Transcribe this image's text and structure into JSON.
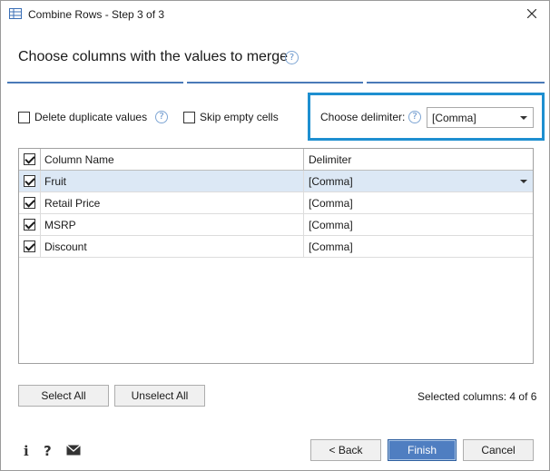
{
  "window": {
    "title": "Combine Rows - Step 3 of 3"
  },
  "header": {
    "title": "Choose columns with the values to merge"
  },
  "options": {
    "delete_duplicates": {
      "label": "Delete duplicate values",
      "checked": false
    },
    "skip_empty": {
      "label": "Skip empty cells",
      "checked": false
    },
    "delimiter_label": "Choose delimiter:",
    "delimiter_value": "[Comma]"
  },
  "grid": {
    "headers": {
      "name": "Column Name",
      "delimiter": "Delimiter"
    },
    "rows": [
      {
        "name": "Fruit",
        "delimiter": "[Comma]",
        "checked": true,
        "selected": true
      },
      {
        "name": "Retail Price",
        "delimiter": "[Comma]",
        "checked": true,
        "selected": false
      },
      {
        "name": "MSRP",
        "delimiter": "[Comma]",
        "checked": true,
        "selected": false
      },
      {
        "name": "Discount",
        "delimiter": "[Comma]",
        "checked": true,
        "selected": false
      }
    ]
  },
  "actions": {
    "select_all": "Select All",
    "unselect_all": "Unselect All",
    "selected_columns": "Selected columns: 4 of 6"
  },
  "footer": {
    "info_icon": "i",
    "help_icon": "?",
    "back": "< Back",
    "finish": "Finish",
    "cancel": "Cancel"
  },
  "colors": {
    "accent": "#1e8fd0",
    "step_bar": "#4a7ab8",
    "selected_row": "#dce8f5",
    "finish_button": "#4f7ec1"
  }
}
